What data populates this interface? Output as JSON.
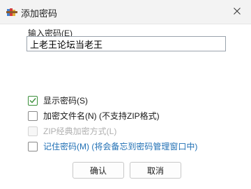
{
  "window": {
    "title": "添加密码",
    "app_icon": "winrar-books-icon",
    "close_icon": "close-icon"
  },
  "password": {
    "label": "输入密码(E)",
    "value": "上老王论坛当老王"
  },
  "options": {
    "show_password": {
      "label": "显示密码(S)",
      "checked": true,
      "enabled": true
    },
    "encrypt_filenames": {
      "label": "加密文件名(N) (不支持ZIP格式)",
      "checked": false,
      "enabled": true
    },
    "zip_legacy": {
      "label": "ZIP经典加密方式(L)",
      "checked": false,
      "enabled": false
    },
    "remember_password": {
      "label": "记住密码(M) (将会备忘到密码管理窗口中)",
      "checked": false,
      "enabled": true
    }
  },
  "buttons": {
    "ok": "确认",
    "cancel": "取消"
  },
  "colors": {
    "accent_green": "#3a8f3a",
    "link_blue": "#1f6fb4"
  }
}
